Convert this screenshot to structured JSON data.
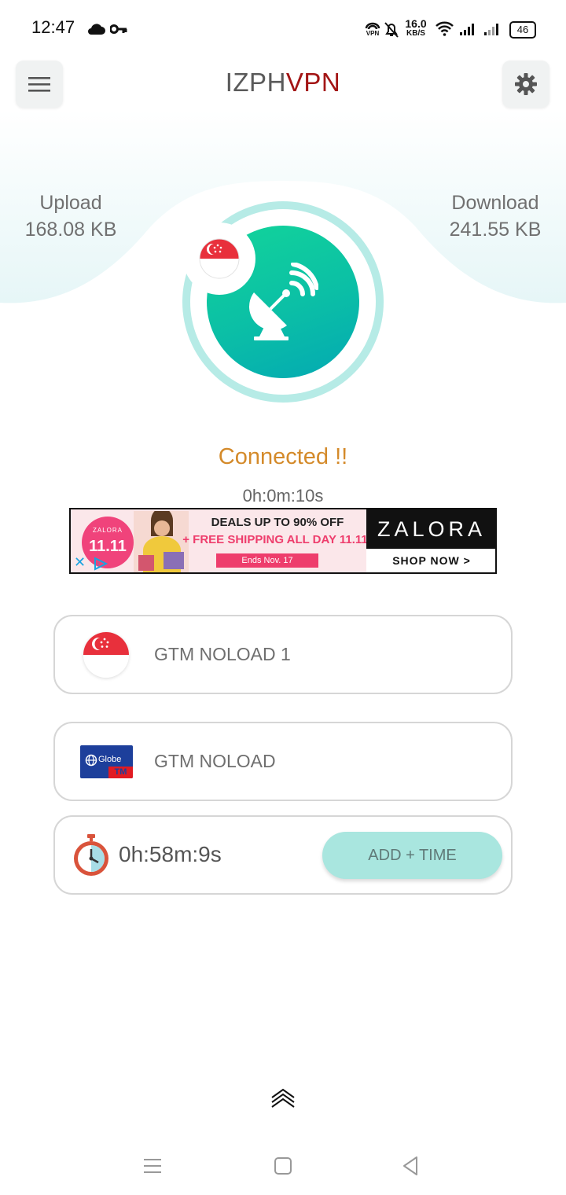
{
  "status_bar": {
    "time": "12:47",
    "vpn_label": "VPN",
    "net_speed_value": "16.0",
    "net_speed_unit": "KB/S",
    "battery": "46",
    "icons": [
      "cloud-icon",
      "key-icon",
      "vpn-icon",
      "bell-off-icon",
      "wifi-icon",
      "signal-icon",
      "signal-weak-icon",
      "battery-icon"
    ]
  },
  "header": {
    "title_part1": "IZPH",
    "title_part2": "VPN",
    "menu_icon": "hamburger-menu-icon",
    "settings_icon": "gear-icon"
  },
  "stats": {
    "upload_label": "Upload",
    "upload_value": "168.08 KB",
    "download_label": "Download",
    "download_value": "241.55 KB"
  },
  "connection": {
    "button_icon": "satellite-dish-icon",
    "country_flag": "singapore-flag-icon",
    "status": "Connected !!",
    "duration": "0h:0m:10s"
  },
  "ad": {
    "brand_small": "ZALORA",
    "date_badge": "11.11",
    "headline_1": "DEALS UP TO 90% OFF",
    "headline_2": "+ FREE SHIPPING ALL DAY 11.11",
    "ends": "Ends Nov. 17",
    "brand": "ZALORA",
    "cta": "SHOP NOW >",
    "close_symbol": "✕"
  },
  "server": {
    "name": "GTM NOLOAD 1",
    "flag_icon": "singapore-flag-icon"
  },
  "network": {
    "name": "GTM NOLOAD",
    "logo_text": "Globe",
    "logo_badge": "TM"
  },
  "timer": {
    "remaining": "0h:58m:9s",
    "button_label": "ADD + TIME",
    "icon": "stopwatch-icon"
  },
  "bottom": {
    "expand_icon": "chevron-double-up-icon"
  },
  "system_nav": {
    "buttons": [
      "recents-icon",
      "home-icon",
      "back-icon"
    ]
  },
  "colors": {
    "accent_green": "#0bbfa6",
    "title_red": "#a31515",
    "status_orange": "#d48a2a",
    "add_time_bg": "#a9e6df"
  }
}
